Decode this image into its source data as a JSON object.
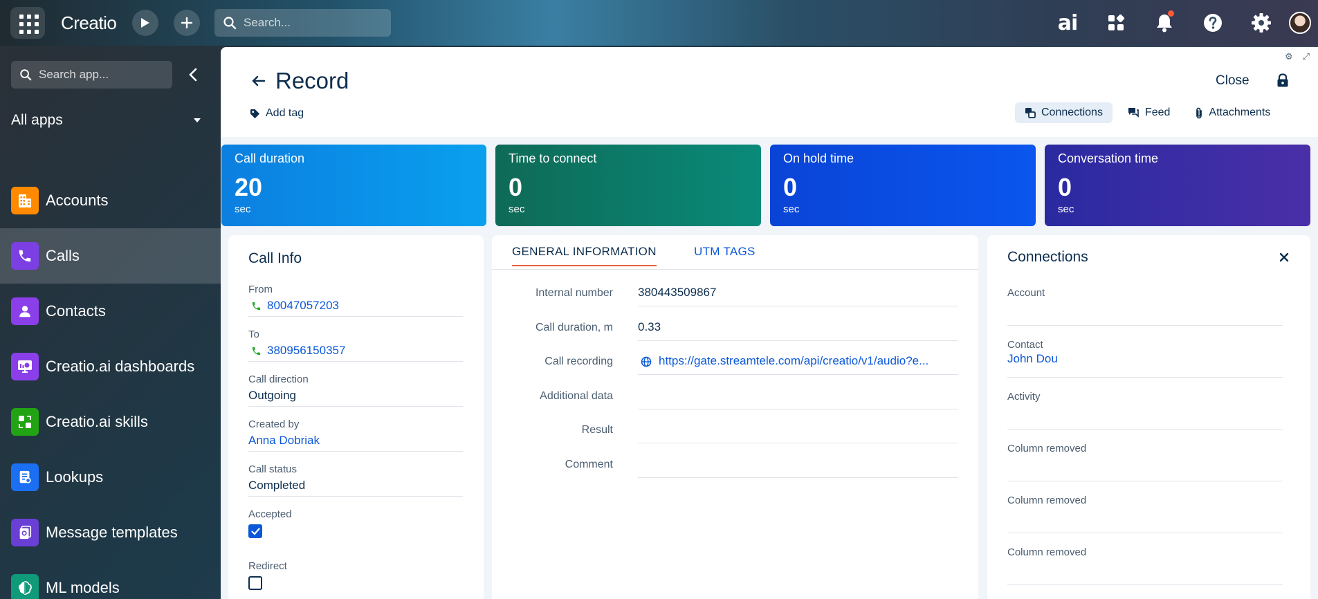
{
  "topbar": {
    "logo": "Creatio",
    "search_placeholder": "Search...",
    "ai_label": "ai"
  },
  "sidebar": {
    "search_placeholder": "Search app...",
    "section_label": "All apps",
    "items": [
      {
        "label": "Accounts",
        "icon": "building-icon",
        "color": "#ff8a00"
      },
      {
        "label": "Calls",
        "icon": "phone-icon",
        "color": "#7b3fe4"
      },
      {
        "label": "Contacts",
        "icon": "person-icon",
        "color": "#8a3fe8"
      },
      {
        "label": "Creatio.ai dashboards",
        "icon": "dashboard-icon",
        "color": "#8a3fe8"
      },
      {
        "label": "Creatio.ai skills",
        "icon": "skills-icon",
        "color": "#22a314"
      },
      {
        "label": "Lookups",
        "icon": "lookup-icon",
        "color": "#1a6ff2"
      },
      {
        "label": "Message templates",
        "icon": "template-icon",
        "color": "#6a3fd6"
      },
      {
        "label": "ML models",
        "icon": "brain-icon",
        "color": "#0f9a7a"
      }
    ]
  },
  "header": {
    "title": "Record",
    "add_tag": "Add tag",
    "close": "Close",
    "tabs": [
      {
        "label": "Connections",
        "icon": "connections-icon"
      },
      {
        "label": "Feed",
        "icon": "feed-icon"
      },
      {
        "label": "Attachments",
        "icon": "paperclip-icon"
      }
    ]
  },
  "kpis": [
    {
      "title": "Call duration",
      "value": "20",
      "unit": "sec",
      "color": "#0b8fe0"
    },
    {
      "title": "Time to connect",
      "value": "0",
      "unit": "sec",
      "color": "#0a7a6a"
    },
    {
      "title": "On hold time",
      "value": "0",
      "unit": "sec",
      "color": "#0a4fe0"
    },
    {
      "title": "Conversation time",
      "value": "0",
      "unit": "sec",
      "color": "#3a2fa0"
    }
  ],
  "call_info": {
    "title": "Call Info",
    "from_label": "From",
    "from_value": "80047057203",
    "to_label": "To",
    "to_value": "380956150357",
    "direction_label": "Call direction",
    "direction_value": "Outgoing",
    "created_label": "Created by",
    "created_value": "Anna Dobriak",
    "status_label": "Call status",
    "status_value": "Completed",
    "accepted_label": "Accepted",
    "accepted": true,
    "redirect_label": "Redirect",
    "redirect": false
  },
  "general": {
    "tab_general": "GENERAL INFORMATION",
    "tab_utm": "UTM TAGS",
    "rows": [
      {
        "label": "Internal number",
        "value": "380443509867"
      },
      {
        "label": "Call duration, m",
        "value": "0.33"
      },
      {
        "label": "Call recording",
        "value": "https://gate.streamtele.com/api/creatio/v1/audio?e..."
      },
      {
        "label": "Additional data",
        "value": ""
      },
      {
        "label": "Result",
        "value": ""
      },
      {
        "label": "Comment",
        "value": ""
      }
    ]
  },
  "connections": {
    "title": "Connections",
    "account_label": "Account",
    "account_value": "",
    "contact_label": "Contact",
    "contact_value": "John Dou",
    "activity_label": "Activity",
    "activity_value": "",
    "removed1": "Column removed",
    "removed2": "Column removed",
    "removed3": "Column removed"
  }
}
